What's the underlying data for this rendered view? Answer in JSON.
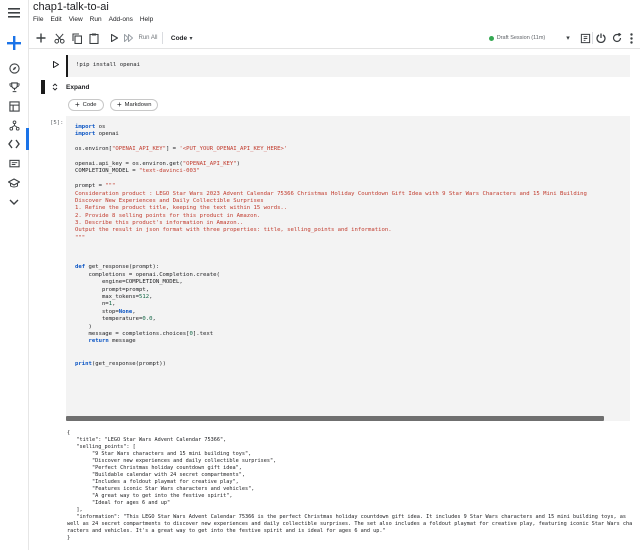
{
  "app": {
    "title": "chap1-talk-to-ai",
    "menu": [
      "File",
      "Edit",
      "View",
      "Run",
      "Add-ons",
      "Help"
    ]
  },
  "toolbar": {
    "run_all_label": "Run All",
    "cell_type_label": "Code",
    "session_label": "Draft Session (11m)",
    "status_color": "#34a853"
  },
  "cells": {
    "pip_cell": {
      "source": "!pip install openai"
    },
    "expand_label": "Expand",
    "add_code_label": "Code",
    "add_markdown_label": "Markdown",
    "execution_count": "[5]:",
    "code_lines": [
      "import os",
      "import openai",
      "",
      "os.environ[\"OPENAI_API_KEY\"] = '<PUT_YOUR_OPENAI_API_KEY_HERE>'",
      "",
      "openai.api_key = os.environ.get(\"OPENAI_API_KEY\")",
      "COMPLETION_MODEL = \"text-davinci-003\"",
      "",
      "prompt = \"\"\"",
      "Consideration product : LEGO Star Wars 2023 Advent Calendar 75366 Christmas Holiday Countdown Gift Idea with 9 Star Wars Characters and 15 Mini Building",
      "Discover New Experiences and Daily Collectible Surprises",
      "1. Refine the product title, keeping the text within 15 words..",
      "2. Provide 8 selling points for this product in Amazon.",
      "3. Describe this product's information in Amazon..",
      "Output the result in json format with three properties: title, selling_points and information.",
      "\"\"\"",
      "",
      "",
      "",
      "def get_response(prompt):",
      "    completions = openai.Completion.create(",
      "        engine=COMPLETION_MODEL,",
      "        prompt=prompt,",
      "        max_tokens=512,",
      "        n=1,",
      "        stop=None,",
      "        temperature=0.0,",
      "    )",
      "    message = completions.choices[0].text",
      "    return message",
      "",
      "",
      "print(get_response(prompt))"
    ],
    "output_lines": [
      "{",
      "   \"title\": \"LEGO Star Wars Advent Calendar 75366\",",
      "   \"selling_points\": [",
      "        \"9 Star Wars characters and 15 mini building toys\",",
      "        \"Discover new experiences and daily collectible surprises\",",
      "        \"Perfect Christmas holiday countdown gift idea\",",
      "        \"Buildable calendar with 24 secret compartments\",",
      "        \"Includes a foldout playmat for creative play\",",
      "        \"Features iconic Star Wars characters and vehicles\",",
      "        \"A great way to get into the festive spirit\",",
      "        \"Ideal for ages 6 and up\"",
      "   ],",
      "   \"information\": \"This LEGO Star Wars Advent Calendar 75366 is the perfect Christmas holiday countdown gift idea. It includes 9 Star Wars characters and 15 mini building toys, as",
      "well as 24 secret compartments to discover new experiences and daily collectible surprises. The set also includes a foldout playmat for creative play, featuring iconic Star Wars cha",
      "racters and vehicles. It's a great way to get into the festive spirit and is ideal for ages 6 and up.\"",
      "}"
    ]
  }
}
